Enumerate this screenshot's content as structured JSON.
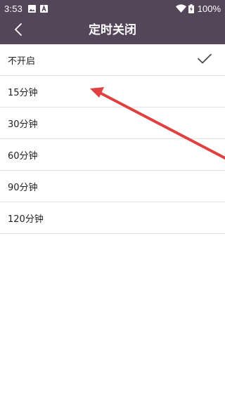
{
  "status_bar": {
    "time": "3:53",
    "battery_percent": "100%",
    "icons": [
      "image-icon",
      "a-badge-icon",
      "wifi-icon",
      "battery-charging-icon"
    ]
  },
  "toolbar": {
    "title": "定时关闭",
    "back_icon": "chevron-left-icon"
  },
  "options": [
    {
      "label": "不开启",
      "selected": true
    },
    {
      "label": "15分钟",
      "selected": false
    },
    {
      "label": "30分钟",
      "selected": false
    },
    {
      "label": "60分钟",
      "selected": false
    },
    {
      "label": "90分钟",
      "selected": false
    },
    {
      "label": "120分钟",
      "selected": false
    }
  ],
  "colors": {
    "header_background": "#534659",
    "divider": "#e3e3e3",
    "annotation_arrow": "#e04040"
  }
}
